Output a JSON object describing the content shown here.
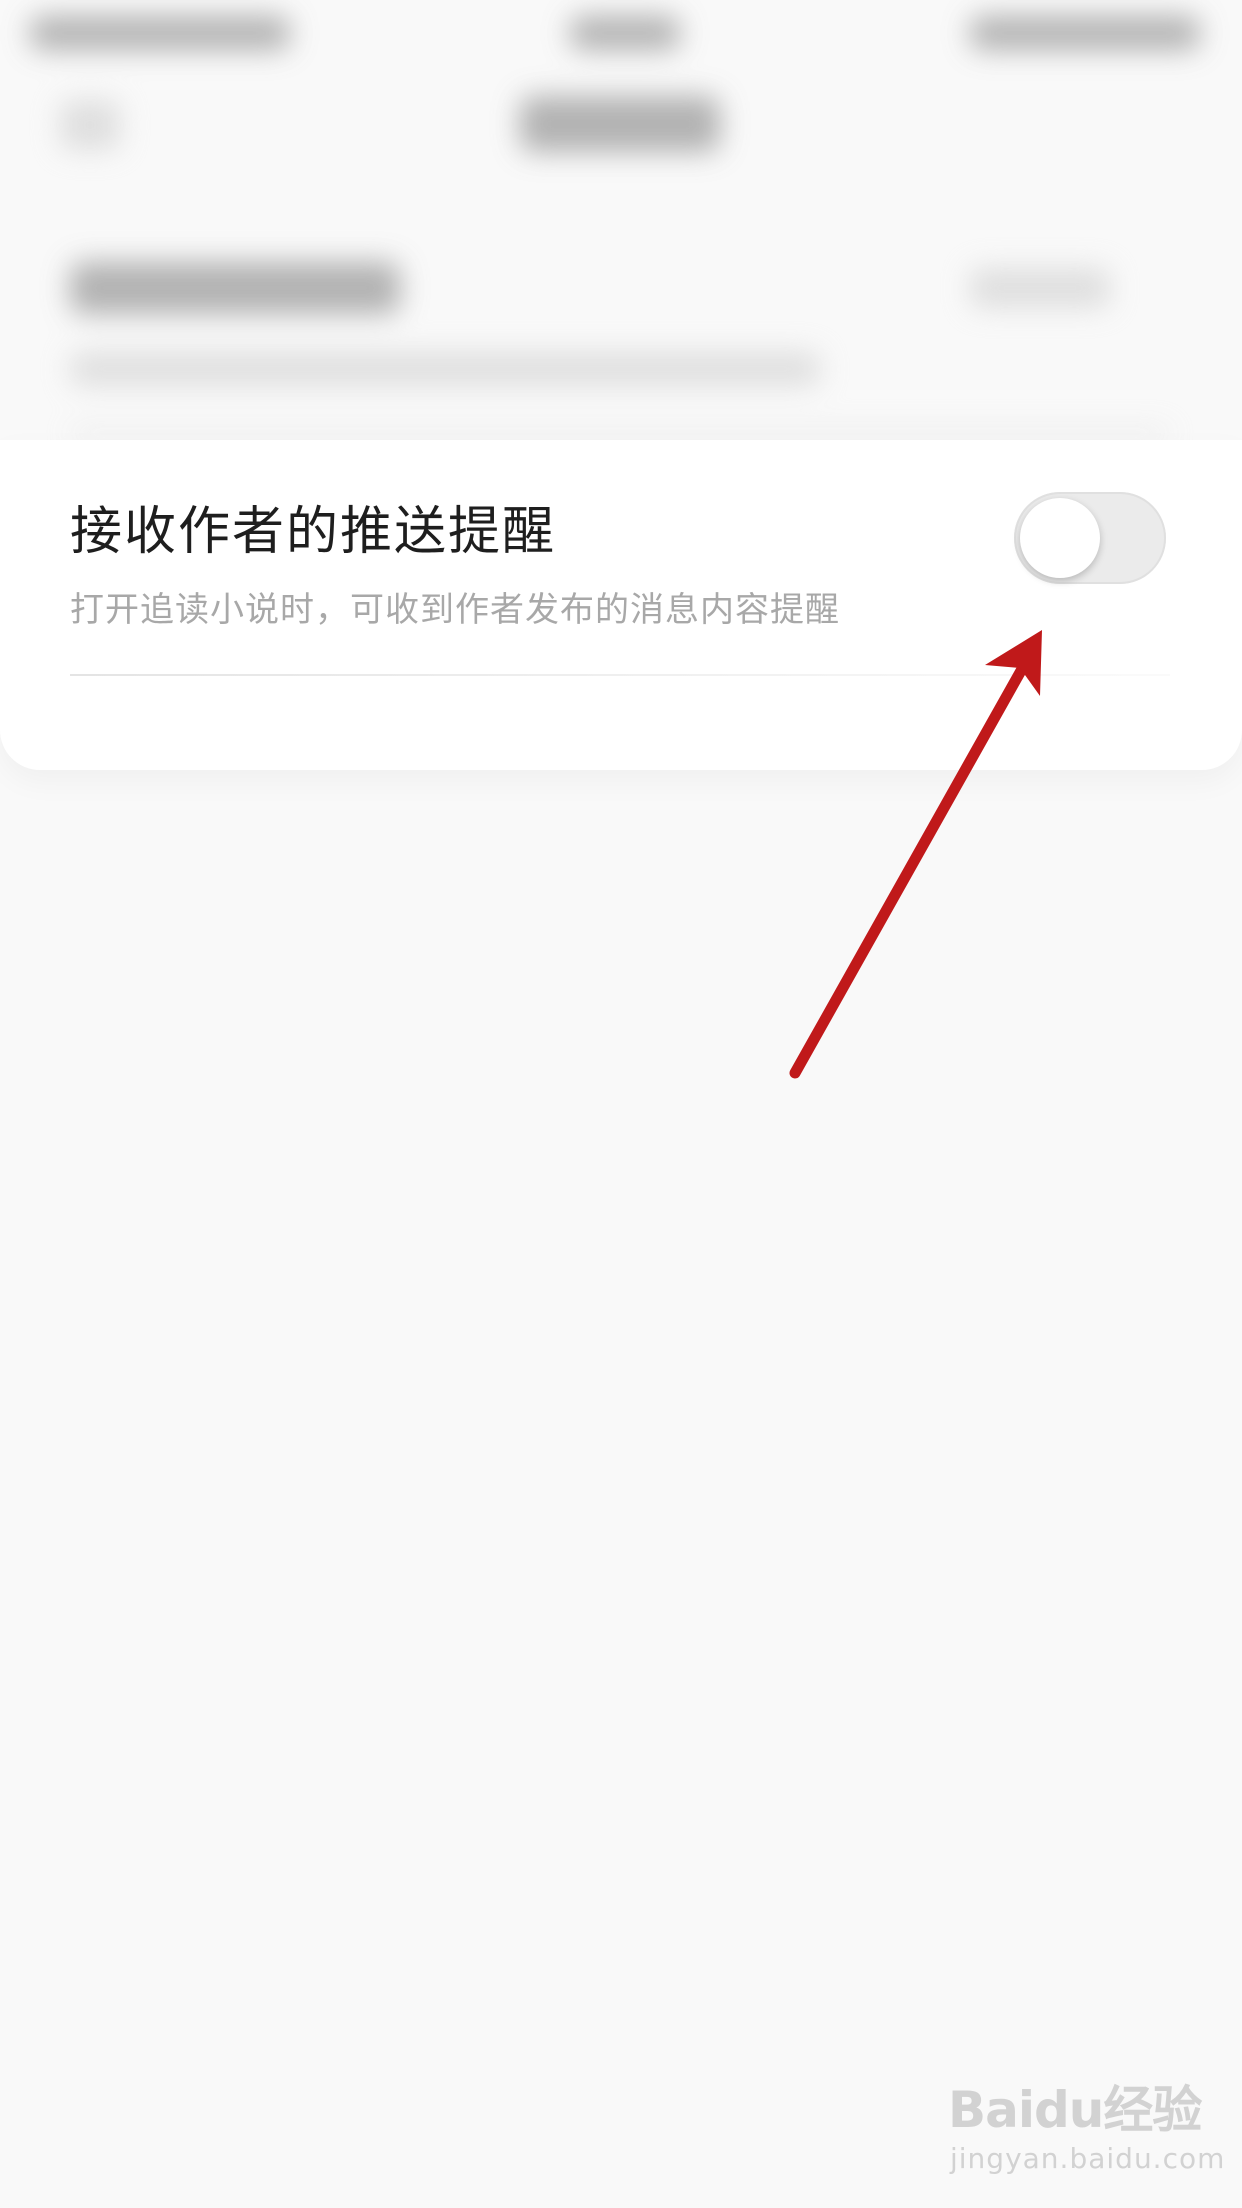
{
  "setting": {
    "title": "接收作者的推送提醒",
    "description": "打开追读小说时，可收到作者发布的消息内容提醒",
    "toggle_on": false
  },
  "annotation": {
    "arrow_color": "#c0191a"
  },
  "watermark": {
    "logo_text": "Baidu经验",
    "url": "jingyan.baidu.com"
  }
}
